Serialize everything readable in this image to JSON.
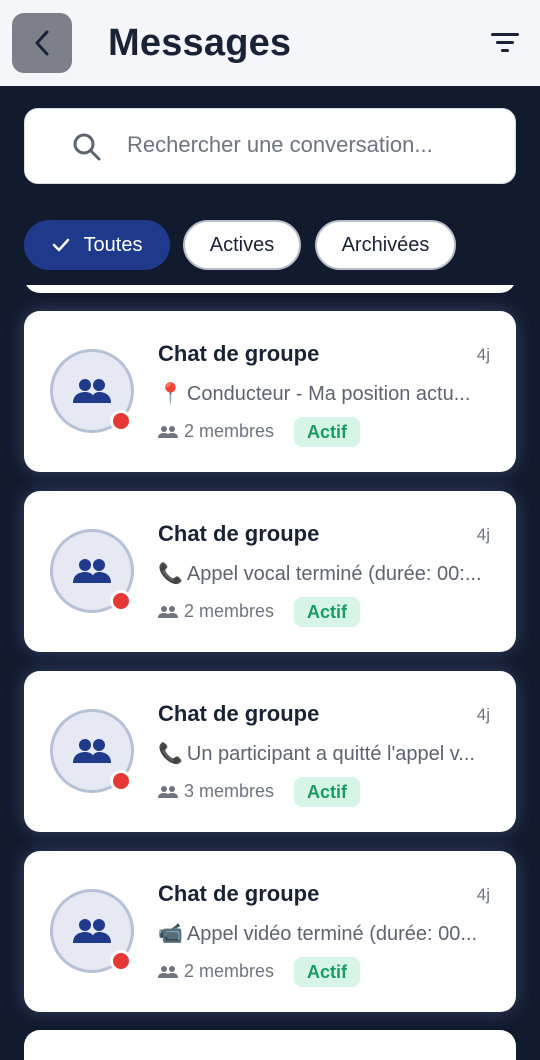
{
  "header": {
    "title": "Messages"
  },
  "search": {
    "placeholder": "Rechercher une conversation..."
  },
  "filters": {
    "all": "Toutes",
    "active": "Actives",
    "archived": "Archivées"
  },
  "conversations": [
    {
      "name": "Chat de groupe",
      "time": "4j",
      "preview_icon": "📍",
      "preview": "Conducteur - Ma position actu...",
      "members": "2 membres",
      "status": "Actif"
    },
    {
      "name": "Chat de groupe",
      "time": "4j",
      "preview_icon": "📞",
      "preview": "Appel vocal terminé (durée: 00:...",
      "members": "2 membres",
      "status": "Actif"
    },
    {
      "name": "Chat de groupe",
      "time": "4j",
      "preview_icon": "📞",
      "preview": "Un participant a quitté l'appel v...",
      "members": "3 membres",
      "status": "Actif"
    },
    {
      "name": "Chat de groupe",
      "time": "4j",
      "preview_icon": "📹",
      "preview": "Appel vidéo terminé (durée: 00...",
      "members": "2 membres",
      "status": "Actif"
    }
  ],
  "colors": {
    "accent": "#1f3a8a",
    "background": "#121a2e",
    "status_red": "#e53935",
    "badge_green": "#1c9a63"
  }
}
